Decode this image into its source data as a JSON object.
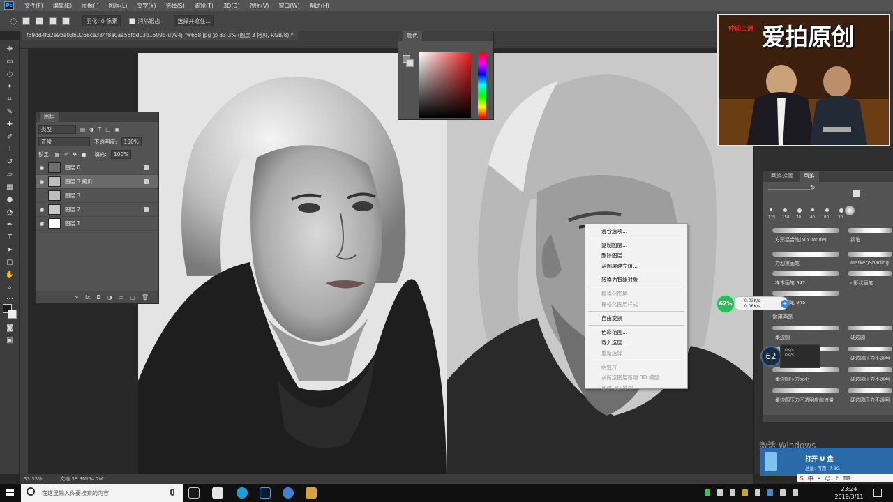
{
  "app": {
    "logo": "Ps",
    "menu": [
      "文件(F)",
      "编辑(E)",
      "图像(I)",
      "图层(L)",
      "文字(Y)",
      "选择(S)",
      "滤镜(T)",
      "3D(D)",
      "视图(V)",
      "窗口(W)",
      "帮助(H)"
    ]
  },
  "options": {
    "feather": "羽化: 0 像素",
    "antialias": "消除锯齿",
    "select_mask": "选择并遮住..."
  },
  "document": {
    "tab_title": "f59dd4f32e9ba03b0268ce384f8a0aa56fdd03b1509d-uyV4j_fw658.jpg @ 33.3% (图层 3 拷贝, RGB/8) *"
  },
  "layers_panel": {
    "tab": "图层",
    "filter_kind": "类型",
    "blend_mode": "正常",
    "opacity_label": "不透明度:",
    "opacity": "100%",
    "lock_label": "锁定:",
    "fill_label": "填充:",
    "fill": "100%",
    "layers": [
      {
        "name": "图层 0",
        "visible": true,
        "selected": false,
        "thumb": "#6f6f6f"
      },
      {
        "name": "图层 3 拷贝",
        "visible": true,
        "selected": true,
        "thumb": "#bdbdbd"
      },
      {
        "name": "图层 3",
        "visible": false,
        "selected": false,
        "thumb": "#bdbdbd"
      },
      {
        "name": "图层 2",
        "visible": true,
        "selected": false,
        "thumb": "#c8c8c8"
      },
      {
        "name": "图层 1",
        "visible": true,
        "selected": false,
        "thumb": "#ffffff"
      }
    ]
  },
  "color_panel": {
    "tab": "颜色"
  },
  "context_menu": {
    "items": [
      {
        "label": "混合选项...",
        "enabled": true
      },
      {
        "sep": true
      },
      {
        "label": "复制图层...",
        "enabled": true
      },
      {
        "label": "删除图层",
        "enabled": true
      },
      {
        "label": "从图层建立组...",
        "enabled": true
      },
      {
        "sep": true
      },
      {
        "label": "转换为智能对象",
        "enabled": true
      },
      {
        "sep": true
      },
      {
        "label": "栅格化图层",
        "enabled": false
      },
      {
        "label": "栅格化图层样式",
        "enabled": false
      },
      {
        "sep": true
      },
      {
        "label": "自由变换",
        "enabled": true
      },
      {
        "sep": true
      },
      {
        "label": "色彩范围...",
        "enabled": true
      },
      {
        "label": "载入选区...",
        "enabled": true
      },
      {
        "label": "重新选择",
        "enabled": false
      },
      {
        "sep": true
      },
      {
        "label": "明信片",
        "enabled": false
      },
      {
        "label": "从所选图层新建 3D 模型",
        "enabled": false
      },
      {
        "label": "新建 3D 模型",
        "enabled": false
      }
    ]
  },
  "brush_panel": {
    "tabs": [
      "画笔设置",
      "画笔"
    ],
    "size_value": "",
    "tip_sizes": [
      "125",
      "150",
      "70",
      "40",
      "80",
      "30"
    ],
    "brushes_left": [
      "方形混合笔(Mix Mode)",
      "刀刮擦画笔",
      "样本画笔 942",
      "样本画笔 945"
    ],
    "brushes_right": [
      "钢笔",
      "Marker/Shading",
      "n形状画笔"
    ],
    "group": "常用画笔",
    "group_left": [
      "柔边圆",
      "柔边圆压力不透明",
      "柔边圆压力大小",
      "柔边圆压力不透明度和流量"
    ],
    "group_right": [
      "硬边圆",
      "硬边圆压力不透明",
      "硬边圆压力不透明",
      "硬边圆压力不透明"
    ]
  },
  "webcam": {
    "watermark": "爱拍原创",
    "corner": "仲印工洲"
  },
  "net_widget": {
    "percent": "62%",
    "up": "0.03K/s",
    "down": "0.06K/s"
  },
  "cpu_widget": {
    "value": "62",
    "line1": "0K/s",
    "line2": "0K/s"
  },
  "windows": {
    "activate": "激活 Windows",
    "usb_title": "打开 U 盘",
    "usb_sub": "总量: 可用: 7.3G",
    "search_placeholder": "在这里输入你要搜索的内容",
    "time": "23:24",
    "date": "2019/3/11"
  },
  "status": {
    "zoom": "33.33%",
    "doc_size": "文档:38.8M/64.7M"
  },
  "colors": {
    "ps_blue": "#31a8ff",
    "selection": "#6a6a6a",
    "usb_blue": "#2a6aa8"
  }
}
